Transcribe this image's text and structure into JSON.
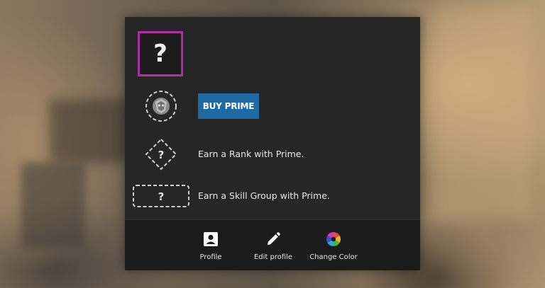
{
  "avatar": {
    "glyph": "?",
    "border_color": "#b12fa6"
  },
  "prime": {
    "icon": "prime-badge-icon",
    "buy_label": "BUY PRIME",
    "button_color": "#1f6aa5"
  },
  "rank": {
    "icon": "rank-unknown-icon",
    "glyph": "?",
    "text": "Earn a Rank with Prime."
  },
  "skill_group": {
    "icon": "skill-group-unknown-icon",
    "glyph": "?",
    "text": "Earn a Skill Group with Prime."
  },
  "footer": {
    "items": [
      {
        "label": "Profile",
        "icon": "profile-icon"
      },
      {
        "label": "Edit profile",
        "icon": "edit-pencil-icon"
      },
      {
        "label": "Change Color",
        "icon": "color-wheel-icon"
      }
    ]
  }
}
